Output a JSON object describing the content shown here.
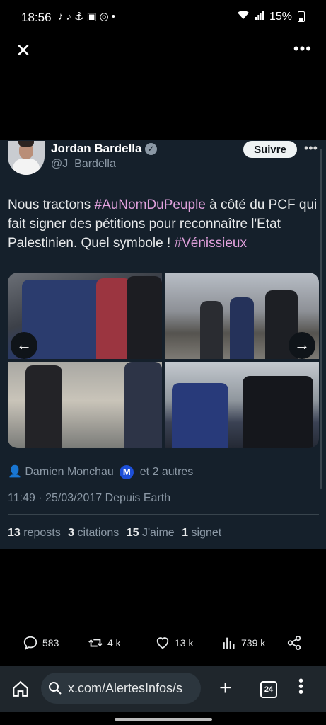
{
  "status_bar": {
    "time": "18:56",
    "notif_icons": "♪♪⚓▣◎•",
    "battery": "15%"
  },
  "viewer": {
    "close_icon": "close-icon",
    "more_icon": "more-icon"
  },
  "tweet": {
    "author_name": "Jordan Bardella",
    "handle": "@J_Bardella",
    "follow_label": "Suivre",
    "text_before": "Nous tractons ",
    "hashtag1": "#AuNomDuPeuple",
    "text_middle": " à côté du PCF qui fait signer des pétitions pour reconnaître l'Etat Palestinien. Quel symbole ! ",
    "hashtag2": "#Vénissieux",
    "signers_name": "Damien Monchau",
    "signers_badge": "M",
    "signers_rest": "et 2 autres",
    "timestamp": "11:49 · 25/03/2017 Depuis Earth",
    "reposts_count": "13",
    "reposts_label": "reposts",
    "citations_count": "3",
    "citations_label": "citations",
    "likes_count": "15",
    "likes_label": "J'aime",
    "bookmarks_count": "1",
    "bookmarks_label": "signet"
  },
  "media": {
    "prev_icon": "←",
    "next_icon": "→"
  },
  "actions": {
    "replies": "583",
    "reposts": "4 k",
    "likes": "13 k",
    "views": "739 k"
  },
  "browser": {
    "url": "x.com/AlertesInfos/s",
    "tab_count": "24"
  },
  "colors": {
    "card_bg": "#15202b",
    "hashtag": "#e0a0dc",
    "muted": "#8b98a5"
  }
}
